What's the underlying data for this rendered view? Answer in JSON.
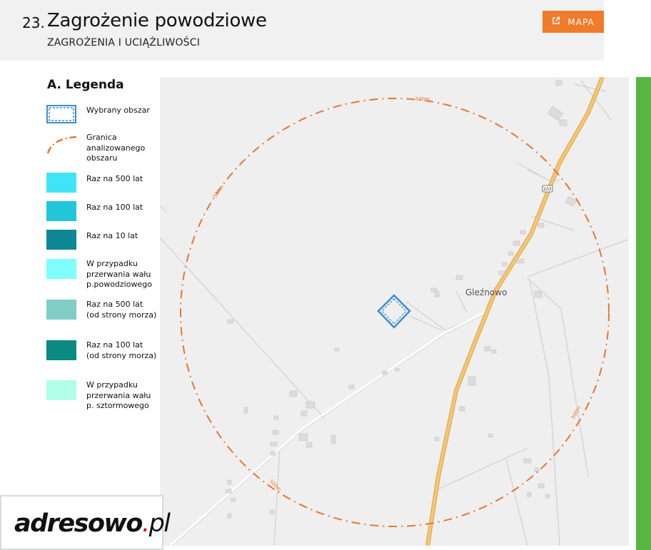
{
  "header": {
    "section_number": "23.",
    "title": "Zagrożenie powodziowe",
    "subtitle": "ZAGROŻENIA I UCIĄŻLIWOŚCI",
    "map_button_label": "MAPA",
    "map_button_icon": "external-link-icon"
  },
  "legend": {
    "title": "A. Legenda",
    "items": [
      {
        "label": "Wybrany obszar",
        "swatch": "selected-area",
        "color": "#3a8fd6"
      },
      {
        "label": "Granica analizowanego obszaru",
        "swatch": "dash-dot-arc",
        "color": "#e8772e"
      },
      {
        "label": "Raz na 500 lat",
        "swatch": "fill",
        "color": "#40e4f7"
      },
      {
        "label": "Raz na 100 lat",
        "swatch": "fill",
        "color": "#22c6d9"
      },
      {
        "label": "Raz na 10 lat",
        "swatch": "fill",
        "color": "#0e8797"
      },
      {
        "label": "W przypadku przerwania wału p.powodziowego",
        "swatch": "fill",
        "color": "#80fdff"
      },
      {
        "label": "Raz na 500 lat (od strony morza)",
        "swatch": "fill",
        "color": "#82ccc6"
      },
      {
        "label": "Raz na 100 lat (od strony morza)",
        "swatch": "fill",
        "color": "#0a8a80"
      },
      {
        "label": "W przypadku przerwania wału p. sztormowego",
        "swatch": "fill",
        "color": "#b0fde8"
      }
    ]
  },
  "map": {
    "place_label": "Gleźnowo",
    "road_shield": "203",
    "radius_labels": [
      "500m",
      "500m",
      "500m",
      "500m"
    ],
    "boundary_color": "#e8772e",
    "road_color": "#f6c670",
    "selection_color": "#3a8fd6"
  },
  "logo": {
    "main": "adresowo",
    "dot": ".",
    "tail": "pl",
    "accent_color": "#e30613"
  },
  "colors": {
    "accent": "#f07b2b",
    "side_bar": "#5bb543",
    "header_bg": "#f1f1f1",
    "map_bg": "#efefef"
  }
}
